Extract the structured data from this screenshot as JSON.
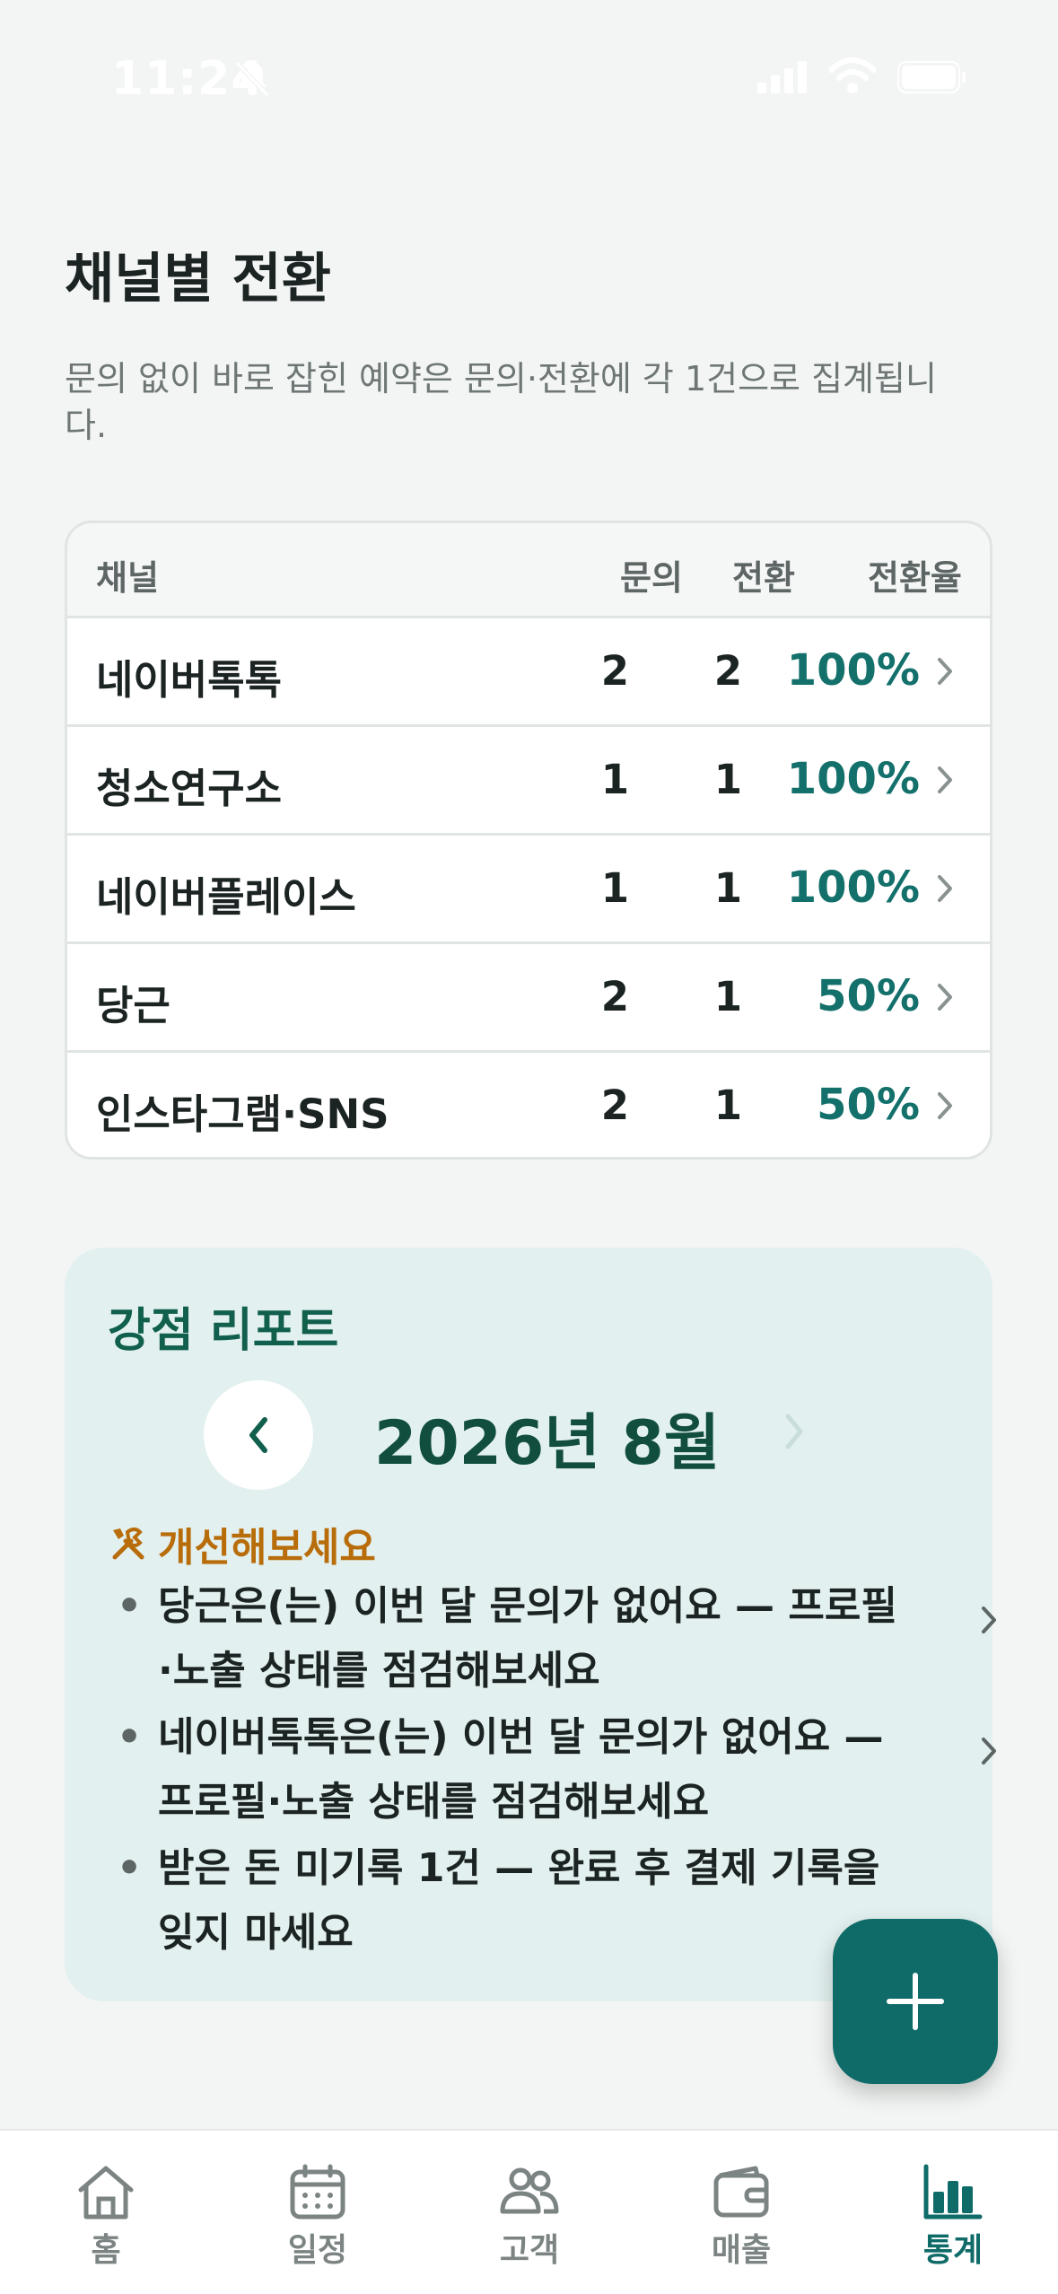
{
  "status_bar": {
    "time": "11:24"
  },
  "section": {
    "title": "채널별 전환",
    "description": "문의 없이 바로 잡힌 예약은 문의·전환에 각 1건으로 집계됩니다."
  },
  "table": {
    "headers": {
      "channel": "채널",
      "inquiries": "문의",
      "conversions": "전환",
      "rate": "전환율"
    },
    "rows": [
      {
        "channel": "네이버톡톡",
        "inquiries": "2",
        "conversions": "2",
        "rate": "100%"
      },
      {
        "channel": "청소연구소",
        "inquiries": "1",
        "conversions": "1",
        "rate": "100%"
      },
      {
        "channel": "네이버플레이스",
        "inquiries": "1",
        "conversions": "1",
        "rate": "100%"
      },
      {
        "channel": "당근",
        "inquiries": "2",
        "conversions": "1",
        "rate": "50%"
      },
      {
        "channel": "인스타그램·SNS",
        "inquiries": "2",
        "conversions": "1",
        "rate": "50%"
      }
    ]
  },
  "report": {
    "title": "강점 리포트",
    "month": "2026년 8월",
    "improve_heading": "개선해보세요",
    "tips": [
      {
        "text": "당근은(는) 이번 달 문의가 없어요 — 프로필·노출 상태를 점검해보세요"
      },
      {
        "text": "네이버톡톡은(는) 이번 달 문의가 없어요 — 프로필·노출 상태를 점검해보세요"
      },
      {
        "text": "받은 돈 미기록 1건 — 완료 후 결제 기록을 잊지 마세요"
      }
    ]
  },
  "tab_bar": {
    "items": [
      {
        "label": "홈",
        "icon": "home-icon"
      },
      {
        "label": "일정",
        "icon": "calendar-icon"
      },
      {
        "label": "고객",
        "icon": "users-icon"
      },
      {
        "label": "매출",
        "icon": "wallet-icon"
      },
      {
        "label": "통계",
        "icon": "bar-chart-icon",
        "active": true
      }
    ]
  },
  "colors": {
    "accent": "#0f6b68",
    "rate_text": "#13706b",
    "warning": "#b86d0a",
    "report_bg": "#e2f0ef"
  }
}
